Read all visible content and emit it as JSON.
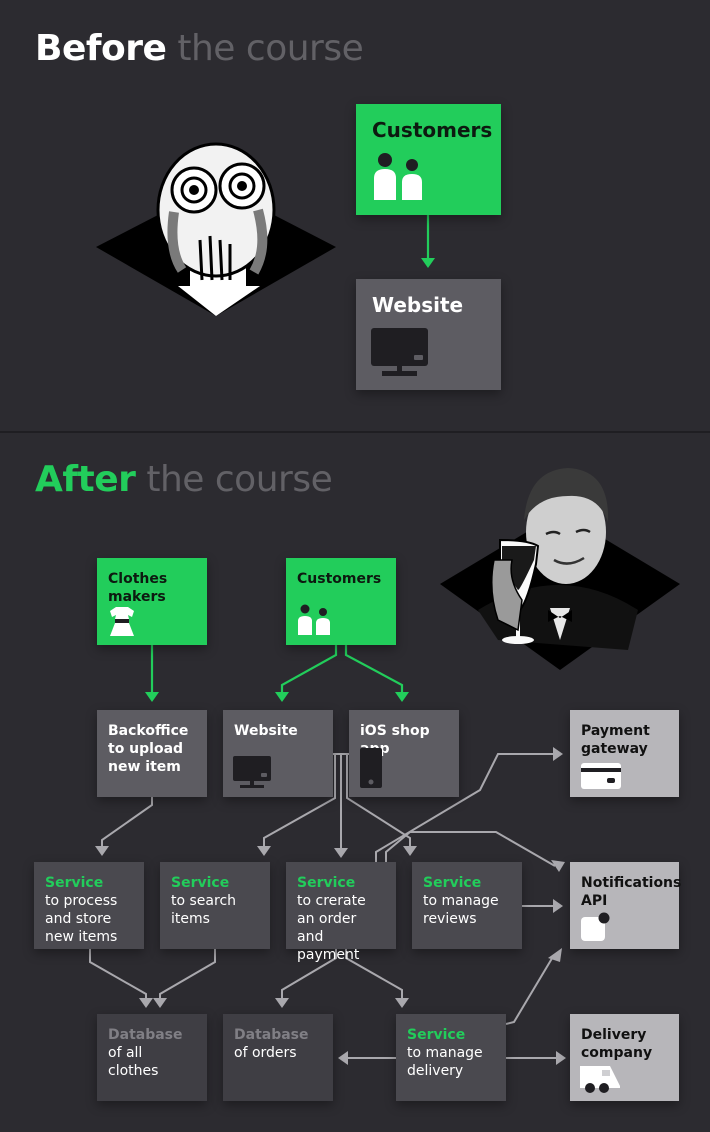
{
  "colors": {
    "accent_green": "#22cd5b",
    "background": "#2c2b30",
    "box_gray": "#5d5c62",
    "box_dark": "#4a494f",
    "box_light": "#b7b6ba",
    "connector": "#a9a8ad"
  },
  "before": {
    "heading_strong": "Before",
    "heading_weak": "the course",
    "illustration": "crying-rage-face",
    "nodes": [
      {
        "id": "customers",
        "label": "Customers",
        "icon": "people-icon"
      },
      {
        "id": "website",
        "label": "Website",
        "icon": "monitor-icon"
      }
    ],
    "edges": [
      [
        "customers",
        "website"
      ]
    ]
  },
  "after": {
    "heading_strong": "After",
    "heading_weak": "the course",
    "illustration": "man-raising-glass",
    "nodes": {
      "clothes_makers": {
        "label": "Clothes\nmakers",
        "icon": "dress-icon"
      },
      "customers": {
        "label": "Customers",
        "icon": "people-icon"
      },
      "backoffice": {
        "label": "Backoffice\nto upload\nnew item"
      },
      "website": {
        "label": "Website",
        "icon": "monitor-icon"
      },
      "ios_app": {
        "label": "iOS shop app",
        "icon": "phone-icon"
      },
      "payment_gateway": {
        "label": "Payment\ngateway",
        "icon": "credit-card-icon"
      },
      "svc_process": {
        "kind": "Service",
        "desc": "to process\nand store\nnew items"
      },
      "svc_search": {
        "kind": "Service",
        "desc": "to search\nitems"
      },
      "svc_order": {
        "kind": "Service",
        "desc": "to crerate\nan order\nand payment"
      },
      "svc_reviews": {
        "kind": "Service",
        "desc": "to manage\nreviews"
      },
      "notifications": {
        "label": "Notifications\nAPI",
        "icon": "notification-icon"
      },
      "db_clothes": {
        "kind": "Database",
        "desc": "of all clothes"
      },
      "db_orders": {
        "kind": "Database",
        "desc": "of orders"
      },
      "svc_delivery": {
        "kind": "Service",
        "desc": "to manage\ndelivery"
      },
      "delivery_company": {
        "label": "Delivery\ncompany",
        "icon": "truck-icon"
      }
    },
    "edges": [
      [
        "clothes_makers",
        "backoffice"
      ],
      [
        "customers",
        "website"
      ],
      [
        "customers",
        "ios_app"
      ],
      [
        "backoffice",
        "svc_process"
      ],
      [
        "website+ios_app",
        "svc_search"
      ],
      [
        "website+ios_app",
        "svc_order"
      ],
      [
        "website+ios_app",
        "svc_reviews"
      ],
      [
        "website+ios_app",
        "payment_gateway"
      ],
      [
        "svc_order",
        "notifications"
      ],
      [
        "svc_reviews",
        "notifications"
      ],
      [
        "svc_process",
        "db_clothes"
      ],
      [
        "svc_search",
        "db_clothes"
      ],
      [
        "svc_order",
        "db_orders"
      ],
      [
        "svc_order",
        "svc_delivery"
      ],
      [
        "svc_delivery",
        "db_orders"
      ],
      [
        "svc_delivery",
        "delivery_company"
      ],
      [
        "svc_delivery",
        "notifications"
      ]
    ]
  }
}
